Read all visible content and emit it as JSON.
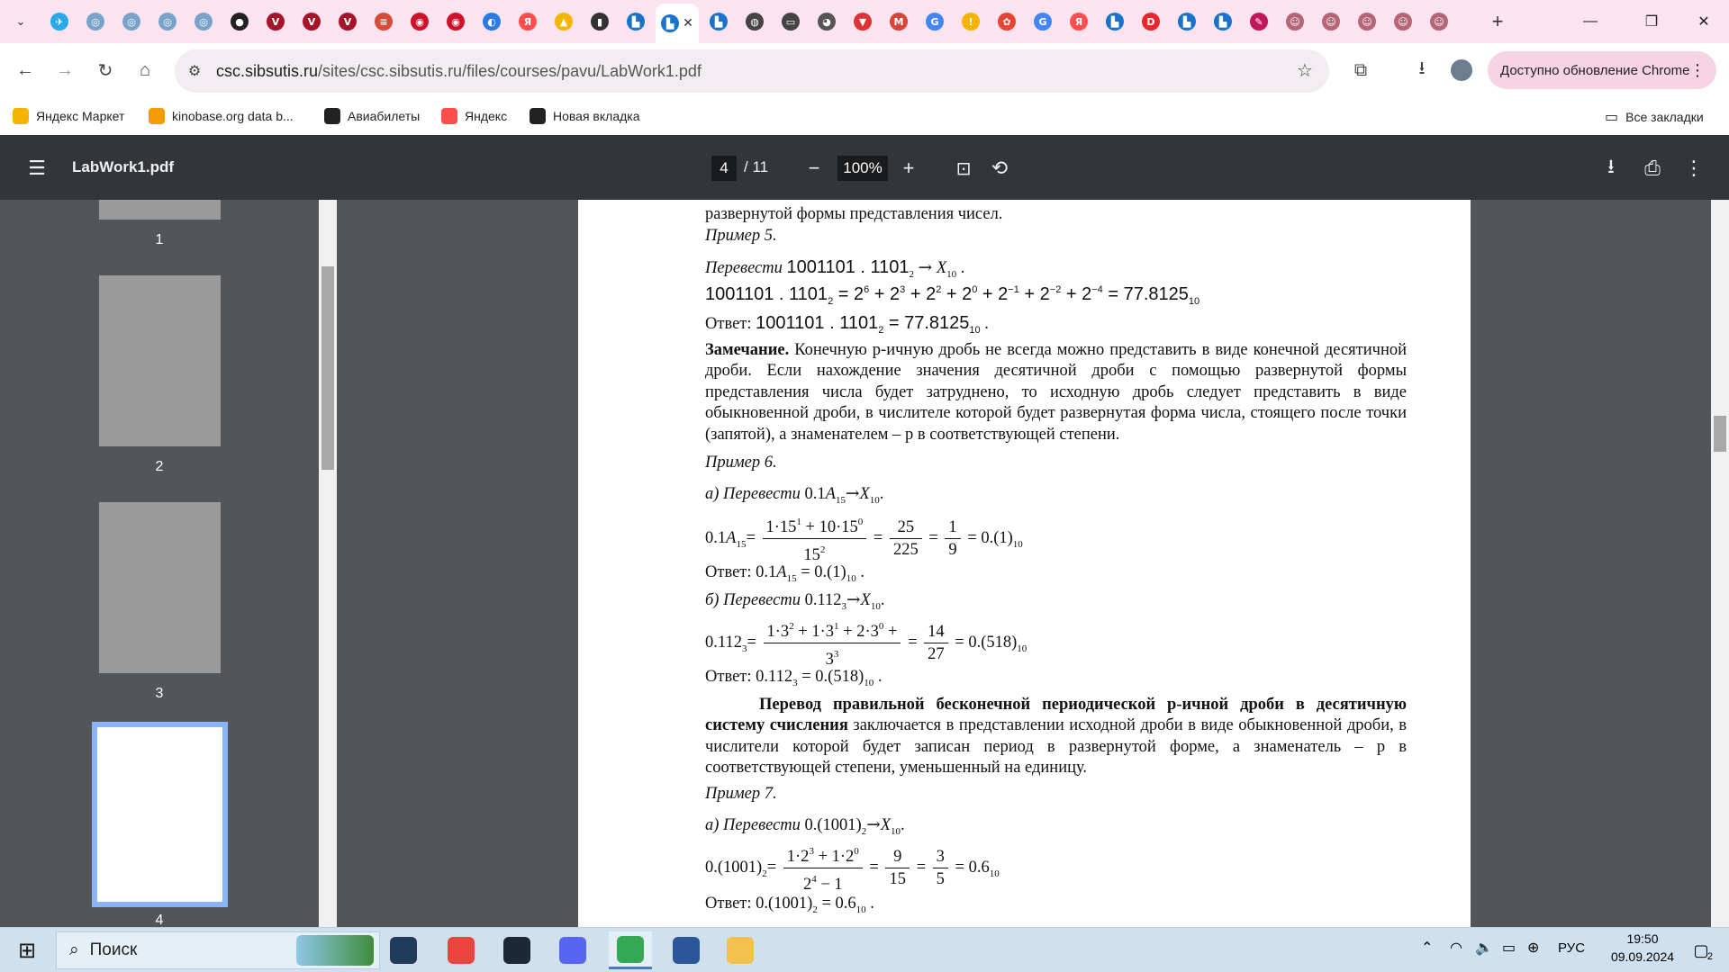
{
  "browser": {
    "tabs": [
      {
        "icon": "telegram-icon",
        "color": "#29a9eb",
        "glyph": "✈"
      },
      {
        "icon": "globe-icon",
        "color": "#7aa3c9",
        "glyph": "◎"
      },
      {
        "icon": "globe-icon",
        "color": "#7aa3c9",
        "glyph": "◎"
      },
      {
        "icon": "globe-icon",
        "color": "#7aa3c9",
        "glyph": "◎"
      },
      {
        "icon": "globe-icon",
        "color": "#7aa3c9",
        "glyph": "◎"
      },
      {
        "icon": "chat-icon",
        "color": "#222",
        "glyph": "●"
      },
      {
        "icon": "v-icon",
        "color": "#a4152b",
        "glyph": "V"
      },
      {
        "icon": "v-icon",
        "color": "#a4152b",
        "glyph": "V"
      },
      {
        "icon": "v-icon",
        "color": "#a4152b",
        "glyph": "V"
      },
      {
        "icon": "books-icon",
        "color": "#d84a3a",
        "glyph": "≡"
      },
      {
        "icon": "record-icon",
        "color": "#d0112b",
        "glyph": "◉"
      },
      {
        "icon": "record-icon",
        "color": "#d0112b",
        "glyph": "◉"
      },
      {
        "icon": "loader-icon",
        "color": "#2c7be5",
        "glyph": "◐"
      },
      {
        "icon": "yandex-icon",
        "color": "#ff4d4d",
        "glyph": "Я"
      },
      {
        "icon": "image-icon",
        "color": "#f5b400",
        "glyph": "▲"
      },
      {
        "icon": "doc-icon",
        "color": "#333",
        "glyph": "▮"
      },
      {
        "icon": "book-icon",
        "color": "#1a73c8",
        "glyph": "▙"
      },
      {
        "icon": "book-icon",
        "color": "#1a73c8",
        "glyph": "▙",
        "active": true
      },
      {
        "icon": "book-icon",
        "color": "#1a73c8",
        "glyph": "▙"
      },
      {
        "icon": "globe-dark-icon",
        "color": "#444",
        "glyph": "◍"
      },
      {
        "icon": "window-icon",
        "color": "#444",
        "glyph": "▭"
      },
      {
        "icon": "github-icon",
        "color": "#555",
        "glyph": "◕"
      },
      {
        "icon": "shield-icon",
        "color": "#d33",
        "glyph": "▼"
      },
      {
        "icon": "gmail-icon",
        "color": "#d44638",
        "glyph": "M"
      },
      {
        "icon": "google-icon",
        "color": "#4285f4",
        "glyph": "G"
      },
      {
        "icon": "info-icon",
        "color": "#f4b400",
        "glyph": "!"
      },
      {
        "icon": "photos-icon",
        "color": "#ea4335",
        "glyph": "✿"
      },
      {
        "icon": "google-icon",
        "color": "#4285f4",
        "glyph": "G"
      },
      {
        "icon": "yandex-icon",
        "color": "#ff4d4d",
        "glyph": "Я"
      },
      {
        "icon": "book-icon",
        "color": "#1a73c8",
        "glyph": "▙"
      },
      {
        "icon": "play-icon",
        "color": "#e8272d",
        "glyph": "D"
      },
      {
        "icon": "book-icon",
        "color": "#1a73c8",
        "glyph": "▙"
      },
      {
        "icon": "book-icon",
        "color": "#1a73c8",
        "glyph": "▙"
      },
      {
        "icon": "pen-icon",
        "color": "#c2185b",
        "glyph": "✎"
      },
      {
        "icon": "avatar-icon",
        "color": "#b56576",
        "glyph": "☺"
      },
      {
        "icon": "avatar-icon",
        "color": "#b56576",
        "glyph": "☺"
      },
      {
        "icon": "avatar-icon",
        "color": "#b56576",
        "glyph": "☺"
      },
      {
        "icon": "avatar-icon",
        "color": "#b56576",
        "glyph": "☺"
      },
      {
        "icon": "avatar-icon",
        "color": "#b56576",
        "glyph": "☺"
      }
    ],
    "url_host": "csc.sibsutis.ru",
    "url_path": "/sites/csc.sibsutis.ru/files/courses/pavu/LabWork1.pdf",
    "update_label": "Доступно обновление Chrome",
    "bookmarks": [
      {
        "label": "Яндекс Маркет",
        "icon": "market-icon",
        "color": "#f5b400"
      },
      {
        "label": "kinobase.org data b...",
        "icon": "kinobase-icon",
        "color": "#f59a00"
      },
      {
        "label": "Авиабилеты",
        "icon": "plane-icon",
        "color": "#222"
      },
      {
        "label": "Яндекс",
        "icon": "yandex-icon",
        "color": "#ff4d4d"
      },
      {
        "label": "Новая вкладка",
        "icon": "globe-icon",
        "color": "#222"
      }
    ],
    "all_bookmarks_label": "Все закладки"
  },
  "pdf": {
    "filename": "LabWork1.pdf",
    "current_page": "4",
    "total_pages": "/ 11",
    "zoom": "100%",
    "thumbnails": [
      "1",
      "2",
      "3",
      "4"
    ],
    "selected_thumbnail": "4"
  },
  "doc": {
    "l1": "развернутой формы представления чисел.",
    "ex5": "Пример 5.",
    "ex5_task": "Перевести",
    "ex5_task_math": "1001101 . 1101",
    "ex5_expand": "1001101 . 1101",
    "ex5_answer_label": "Ответ:",
    "ex5_answer": "1001101 . 1101",
    "remark_label": "Замечание.",
    "remark_text": "Конечную p-ичную дробь не всегда можно представить в виде конечной десятичной дроби. Если нахождение значения десятичной дроби с помощью развернутой формы представления числа будет затруднено, то исходную дробь следует представить в виде обыкновенной дроби, в числителе которой будет развернутая форма числа, стоящего после точки (запятой), а знаменателем – p в соответствующей степени.",
    "ex6": "Пример 6.",
    "ex6a": "а) Перевести",
    "ex6b": "б) Перевести",
    "answer_label": "Ответ:",
    "periodic_heading": "Перевод правильной бесконечной периодической p-ичной дроби в десятичную систему счисления",
    "periodic_text": "заключается в представлении исходной дроби в виде обыкновенной дроби, в числители которой будет записан период в развернутой форме, а знаменатель – p в соответствующей степени, уменьшенный на единицу.",
    "ex7": "Пример 7.",
    "ex7a": "а) Перевести"
  },
  "taskbar": {
    "search_label": "Поиск",
    "lang": "РУС",
    "time": "19:50",
    "date": "09.09.2024",
    "notification_count": "2",
    "apps": [
      {
        "name": "taskview-icon",
        "color": "#1f3a5a"
      },
      {
        "name": "chrome-icon",
        "color": "#e8453c"
      },
      {
        "name": "steam-icon",
        "color": "#1b2838"
      },
      {
        "name": "discord-chrome-icon",
        "color": "#5865f2"
      },
      {
        "name": "chrome-active-icon",
        "color": "#34a853",
        "active": true
      },
      {
        "name": "word-icon",
        "color": "#2b579a"
      },
      {
        "name": "explorer-icon",
        "color": "#f2c14e"
      }
    ]
  }
}
